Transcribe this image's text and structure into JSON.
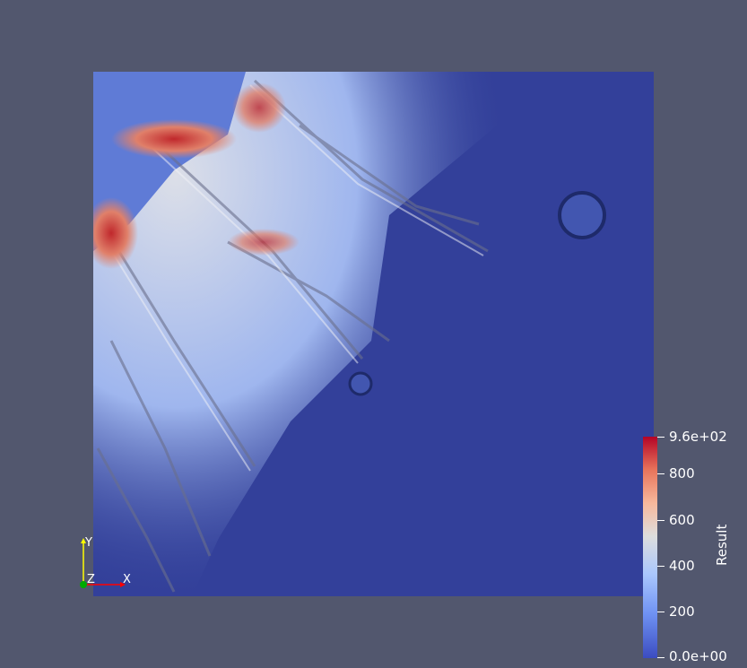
{
  "viewport": {
    "background": "#52576e"
  },
  "legend": {
    "title": "Result",
    "colormap": [
      "#3b4cc0",
      "#6f92f3",
      "#aac7fd",
      "#dddddd",
      "#f7b89c",
      "#e7745b",
      "#b40426"
    ],
    "range": [
      0,
      960
    ],
    "ticks": [
      {
        "label": "9.6e+02",
        "value": 960
      },
      {
        "label": "800",
        "value": 800
      },
      {
        "label": "600",
        "value": 600
      },
      {
        "label": "400",
        "value": 400
      },
      {
        "label": "200",
        "value": 200
      },
      {
        "label": "0.0e+00",
        "value": 0
      }
    ]
  },
  "axes_triad": {
    "y_label": "Y",
    "z_label": "Z",
    "x_label": "X",
    "y_color": "#ffff00",
    "x_color": "#ff0000",
    "z_color": "#00aa00"
  }
}
